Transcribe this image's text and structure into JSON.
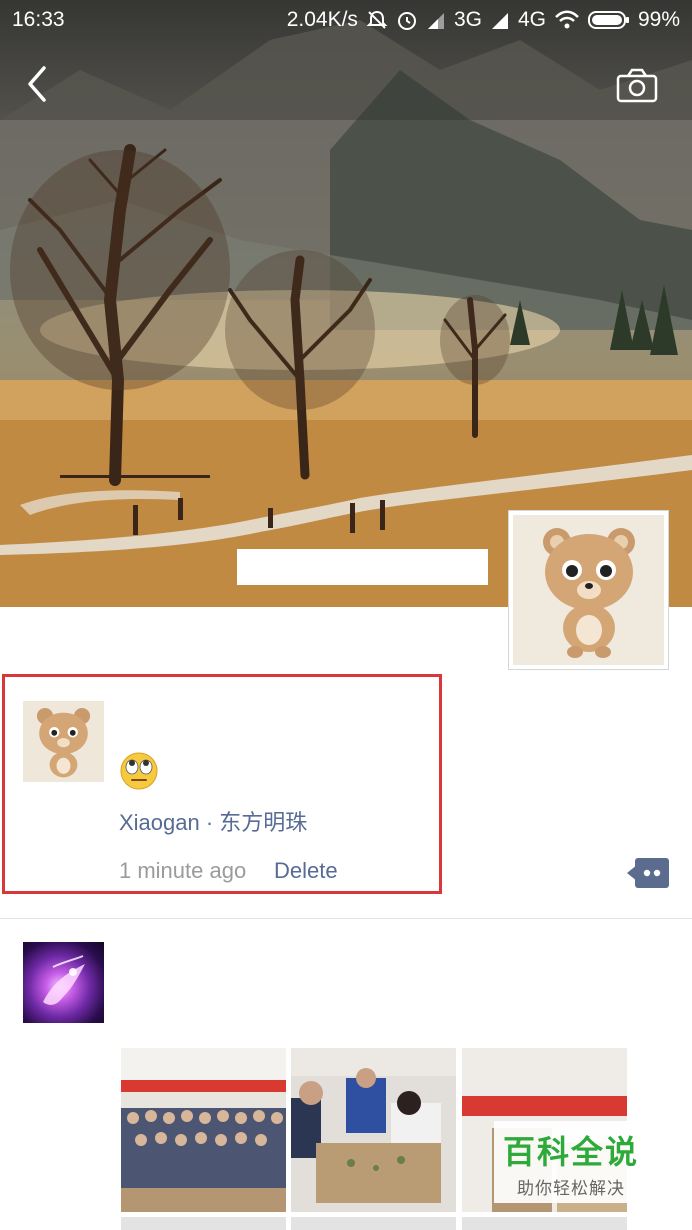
{
  "status_bar": {
    "time": "16:33",
    "speed": "2.04K/s",
    "network_3g": "3G",
    "network_4g": "4G",
    "battery": "99%"
  },
  "nav": {
    "back_icon": "chevron-left-icon",
    "camera_icon": "camera-icon"
  },
  "post1": {
    "emoji": "🙄",
    "location": "Xiaogan · 东方明珠",
    "time_ago": "1 minute ago",
    "delete_label": "Delete"
  },
  "watermark": {
    "title": "百科全说",
    "subtitle": "助你轻松解决"
  },
  "colors": {
    "link": "#576b95",
    "muted": "#9b9b9b",
    "highlight_box": "#d9383a",
    "watermark_green": "#2daa3a"
  }
}
